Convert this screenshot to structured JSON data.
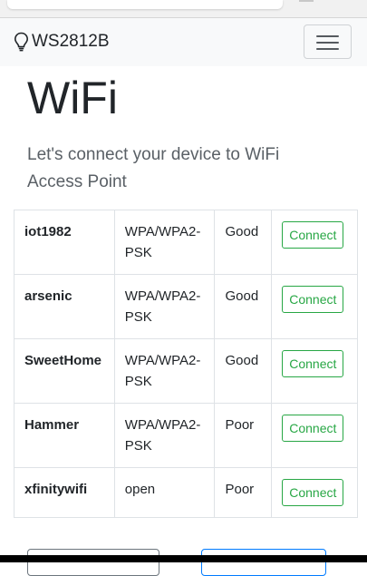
{
  "navbar": {
    "brand": "WS2812B",
    "brand_icon": "lightbulb-icon",
    "toggler_icon": "hamburger-menu-icon"
  },
  "page": {
    "title": "WiFi",
    "lead": "Let's connect your device to WiFi Access Point"
  },
  "networks": [
    {
      "ssid": "iot1982",
      "security": "WPA/WPA2-PSK",
      "signal": "Good",
      "action": "Connect"
    },
    {
      "ssid": "arsenic",
      "security": "WPA/WPA2-PSK",
      "signal": "Good",
      "action": "Connect"
    },
    {
      "ssid": "SweetHome",
      "security": "WPA/WPA2-PSK",
      "signal": "Good",
      "action": "Connect"
    },
    {
      "ssid": "Hammer",
      "security": "WPA/WPA2-PSK",
      "signal": "Poor",
      "action": "Connect"
    },
    {
      "ssid": "xfinitywifi",
      "security": "open",
      "signal": "Poor",
      "action": "Connect"
    }
  ],
  "colors": {
    "connect_accent": "#28a745",
    "navbar_bg": "#f8f9fa",
    "secondary_outline": "#6c757d",
    "primary_outline": "#007bff"
  }
}
